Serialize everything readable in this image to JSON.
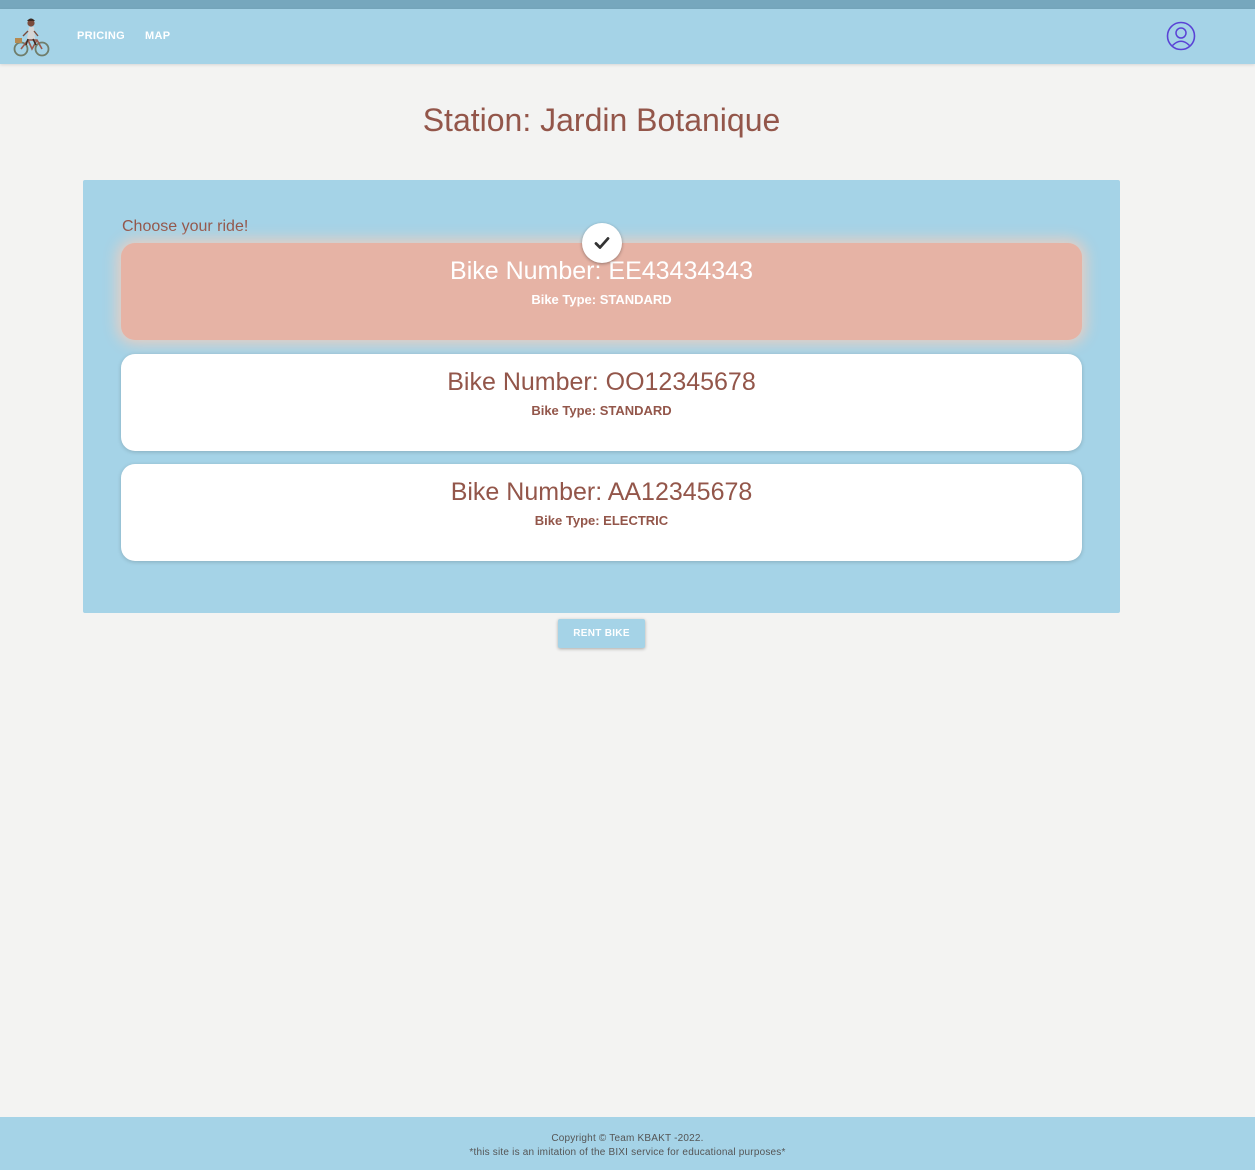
{
  "nav": {
    "links": [
      "PRICING",
      "MAP"
    ]
  },
  "page": {
    "title": "Station: Jardin Botanique",
    "choose_label": "Choose your ride!"
  },
  "bikes": [
    {
      "number": "Bike Number: EE43434343",
      "type_label": "Bike Type: STANDARD",
      "selected": true
    },
    {
      "number": "Bike Number: OO12345678",
      "type_label": "Bike Type: STANDARD",
      "selected": false
    },
    {
      "number": "Bike Number: AA12345678",
      "type_label": "Bike Type: ELECTRIC",
      "selected": false
    }
  ],
  "actions": {
    "rent_label": "RENT BIKE"
  },
  "footer": {
    "copyright": "Copyright © Team KBAKT -2022.",
    "disclaimer": "*this site is an imitation of the BIXI service for educational purposes*"
  },
  "icons": {
    "logo": "cyclist-logo-icon",
    "account": "user-account-icon",
    "selected": "checkmark-icon"
  },
  "colors": {
    "brand_blue": "#a5d3e7",
    "accent_brown": "#93564a",
    "selected_card": "#e6b3a5",
    "page_bg": "#f3f3f2"
  }
}
